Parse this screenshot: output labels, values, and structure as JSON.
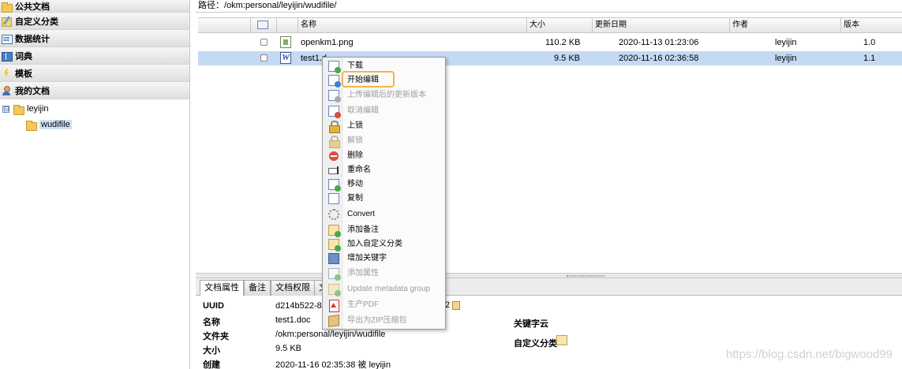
{
  "sidebar": {
    "items": [
      {
        "label": "公共文档",
        "icon": "folder-icon"
      },
      {
        "label": "自定义分类",
        "icon": "category-icon"
      },
      {
        "label": "数据统计",
        "icon": "stats-icon"
      },
      {
        "label": "词典",
        "icon": "dictionary-icon"
      },
      {
        "label": "模板",
        "icon": "template-icon"
      },
      {
        "label": "我的文档",
        "icon": "user-icon"
      }
    ],
    "tree": {
      "root": {
        "label": "leyijin",
        "toggle": "⊟"
      },
      "child": {
        "label": "wudifile"
      }
    }
  },
  "path": {
    "text": "路径：/okm:personal/leyijin/wudifile/"
  },
  "grid": {
    "columns": {
      "name": "名称",
      "size": "大小",
      "date": "更新日期",
      "author": "作者",
      "version": "版本"
    },
    "rows": [
      {
        "name": "openkm1.png",
        "size": "110.2 KB",
        "date": "2020-11-13 01:23:06",
        "author": "leyijin",
        "version": "1.0",
        "type": "image"
      },
      {
        "name": "test1.d",
        "size": "9.5 KB",
        "date": "2020-11-16 02:36:58",
        "author": "leyijin",
        "version": "1.1",
        "type": "word"
      }
    ]
  },
  "context_menu": {
    "items": [
      {
        "label": "下载",
        "enabled": true
      },
      {
        "label": "开始编辑",
        "enabled": true,
        "highlighted": true
      },
      {
        "label": "上传编辑后的更新版本",
        "enabled": false
      },
      {
        "label": "取消编辑",
        "enabled": false
      },
      {
        "label": "上锁",
        "enabled": true
      },
      {
        "label": "解锁",
        "enabled": false
      },
      {
        "label": "删除",
        "enabled": true
      },
      {
        "label": "重命名",
        "enabled": true
      },
      {
        "label": "移动",
        "enabled": true
      },
      {
        "label": "复制",
        "enabled": true
      },
      {
        "label": "Convert",
        "enabled": true
      },
      {
        "label": "添加备注",
        "enabled": true
      },
      {
        "label": "加入自定义分类",
        "enabled": true
      },
      {
        "label": "增加关键字",
        "enabled": true
      },
      {
        "label": "添加属性",
        "enabled": false
      },
      {
        "label": "Update metadata group",
        "enabled": false
      },
      {
        "label": "生产PDF",
        "enabled": false
      },
      {
        "label": "导出为ZIP压缩包",
        "enabled": false
      }
    ],
    "highlight_color": "#f5b443"
  },
  "tabs": [
    {
      "label": "文档属性",
      "active": true
    },
    {
      "label": "备注"
    },
    {
      "label": "文档权限"
    },
    {
      "label": "文"
    }
  ],
  "properties": {
    "uuid_label": "UUID",
    "uuid_value": "d214b522-8",
    "uuid_tail": "2",
    "name_label": "名称",
    "name_value": "test1.doc",
    "folder_label": "文件夹",
    "folder_value": "/okm:personal/leyijin/wudifile",
    "size_label": "大小",
    "size_value": "9.5 KB",
    "created_label": "创建",
    "created_value": "2020-11-16 02:35:38 被 leyijin",
    "keywords_label": "关键字云",
    "category_label": "自定义分类"
  },
  "watermark": "https://blog.csdn.net/bigwood99",
  "colors": {
    "selection": "#c4d9f3",
    "accent": "#f5b443"
  }
}
